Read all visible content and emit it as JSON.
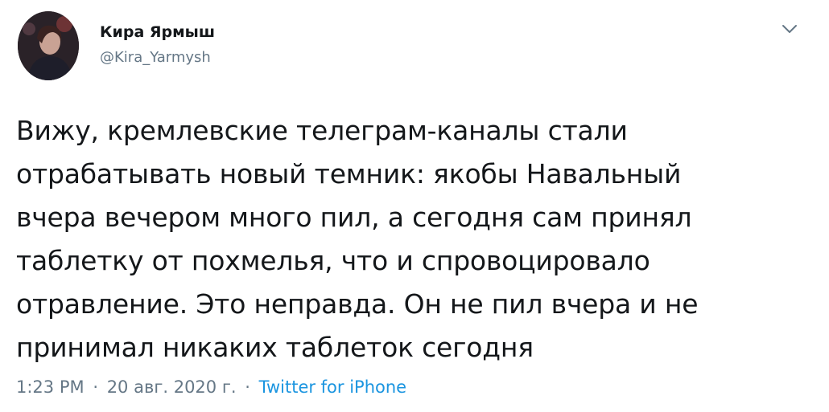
{
  "author": {
    "display_name": "Кира Ярмыш",
    "handle": "@Kira_Yarmysh",
    "avatar_icon": "avatar-photo"
  },
  "menu": {
    "icon": "chevron-down-icon"
  },
  "tweet": {
    "text": "Вижу, кремлевские телеграм-каналы стали\nотрабатывать новый темник: якобы Навальный\nвчера вечером много пил, а сегодня сам принял\nтаблетку от похмелья, что и спровоцировало\nотравление. Это неправда. Он не пил вчера и не\nпринимал никаких таблеток сегодня",
    "time": "1:23 PM",
    "separator": "·",
    "date": "20 авг. 2020 г.",
    "source": "Twitter for iPhone"
  },
  "colors": {
    "text": "#14171a",
    "secondary": "#657786",
    "link": "#1b95e0"
  }
}
